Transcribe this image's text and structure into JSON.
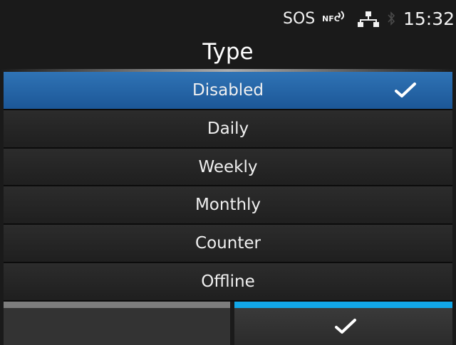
{
  "status_bar": {
    "sos": "SOS",
    "nfc": "NFC",
    "time": "15:32",
    "icons": [
      "nfc-icon",
      "network-icon",
      "bluetooth-icon"
    ]
  },
  "title": "Type",
  "options": [
    {
      "label": "Disabled",
      "selected": true
    },
    {
      "label": "Daily",
      "selected": false
    },
    {
      "label": "Weekly",
      "selected": false
    },
    {
      "label": "Monthly",
      "selected": false
    },
    {
      "label": "Counter",
      "selected": false
    },
    {
      "label": "Offline",
      "selected": false
    }
  ],
  "softkeys": {
    "left": "",
    "right_icon": "check-icon"
  },
  "colors": {
    "selected": "#2a6aad",
    "accent": "#12a7e8"
  }
}
